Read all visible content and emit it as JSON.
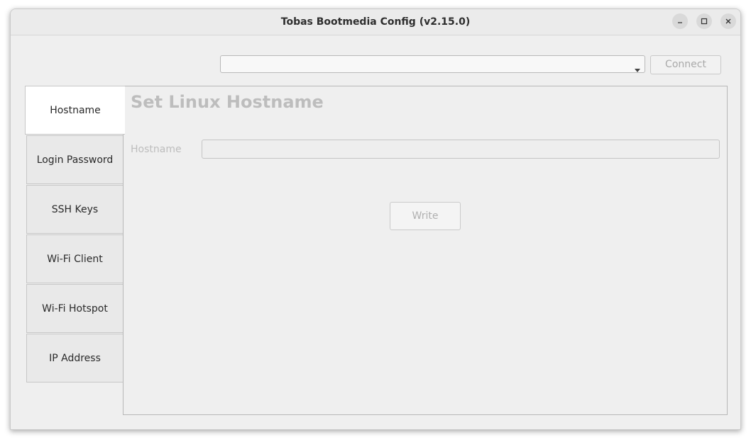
{
  "window": {
    "title": "Tobas Bootmedia Config (v2.15.0)",
    "controls": {
      "minimize": "minimize-icon",
      "maximize": "maximize-icon",
      "close": "close-icon"
    }
  },
  "toolbar": {
    "port_select_value": "",
    "connect_label": "Connect"
  },
  "tabs": [
    {
      "label": "Hostname",
      "active": true
    },
    {
      "label": "Login Password",
      "active": false
    },
    {
      "label": "SSH Keys",
      "active": false
    },
    {
      "label": "Wi-Fi Client",
      "active": false
    },
    {
      "label": "Wi-Fi Hotspot",
      "active": false
    },
    {
      "label": "IP Address",
      "active": false
    }
  ],
  "panel": {
    "title": "Set Linux Hostname",
    "hostname_label": "Hostname",
    "hostname_value": "",
    "write_label": "Write"
  }
}
